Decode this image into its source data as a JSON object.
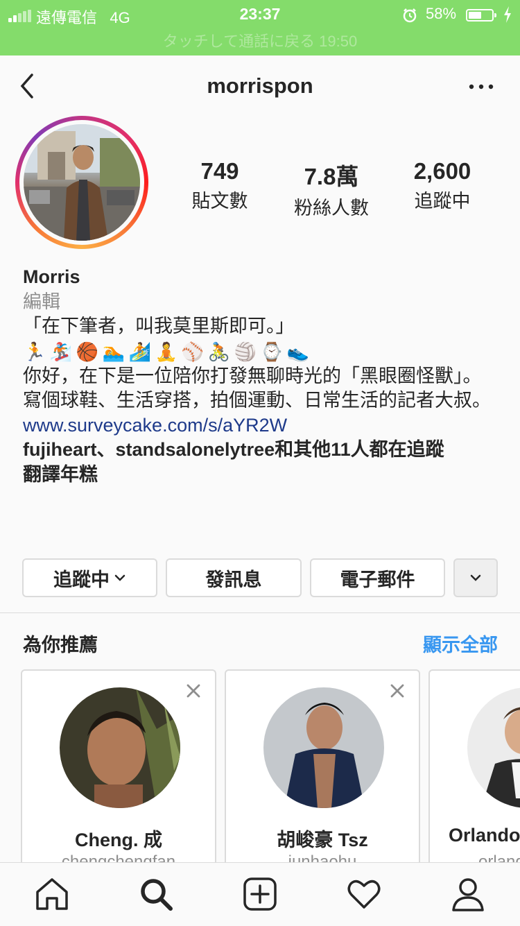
{
  "status_bar": {
    "carrier": "遠傳電信",
    "network": "4G",
    "time": "23:37",
    "battery_percent": "58%",
    "battery_level": 0.58,
    "call_banner": "タッチして通話に戻る 19:50"
  },
  "header": {
    "username": "morrispon",
    "back_icon": "chevron-left-icon",
    "more_icon": "ellipsis-icon"
  },
  "profile": {
    "stats": [
      {
        "value": "749",
        "label": "貼文數"
      },
      {
        "value": "7.8萬",
        "label": "粉絲人數"
      },
      {
        "value": "2,600",
        "label": "追蹤中"
      }
    ],
    "name": "Morris",
    "edit_label": "編輯",
    "bio_line1": "「在下筆者，叫我莫里斯即可。」",
    "bio_emojis": [
      "🏃",
      "🏂",
      "🏀",
      "🏊",
      "🏄",
      "🧘",
      "⚾",
      "🚴",
      "🏐",
      "⌚",
      "👟"
    ],
    "bio_line2": "你好，在下是一位陪你打發無聊時光的「黑眼圈怪獸」。",
    "bio_line3": "寫個球鞋、生活穿搭，拍個運動、日常生活的記者大叔。",
    "link": "www.surveycake.com/s/aYR2W",
    "followed_by": "fujiheart、standsalonelytree和其他11人都在追蹤",
    "translate": "翻譯年糕"
  },
  "actions": {
    "following": "追蹤中",
    "message": "發訊息",
    "email": "電子郵件"
  },
  "suggestions": {
    "title": "為你推薦",
    "see_all": "顯示全部",
    "cards": [
      {
        "name": "Cheng. 成",
        "username": "chengchengfan"
      },
      {
        "name": "胡峻豪 Tsz",
        "username": "junhaohu"
      },
      {
        "name": "Orlando",
        "username": "orlando"
      }
    ]
  },
  "tabbar": [
    "home-icon",
    "search-icon",
    "new-post-icon",
    "activity-heart-icon",
    "profile-icon"
  ],
  "colors": {
    "status_bar": "#84dc6b",
    "link_blue": "#3897f0",
    "bio_link": "#1e3a8a",
    "border": "#dbdbdb"
  }
}
